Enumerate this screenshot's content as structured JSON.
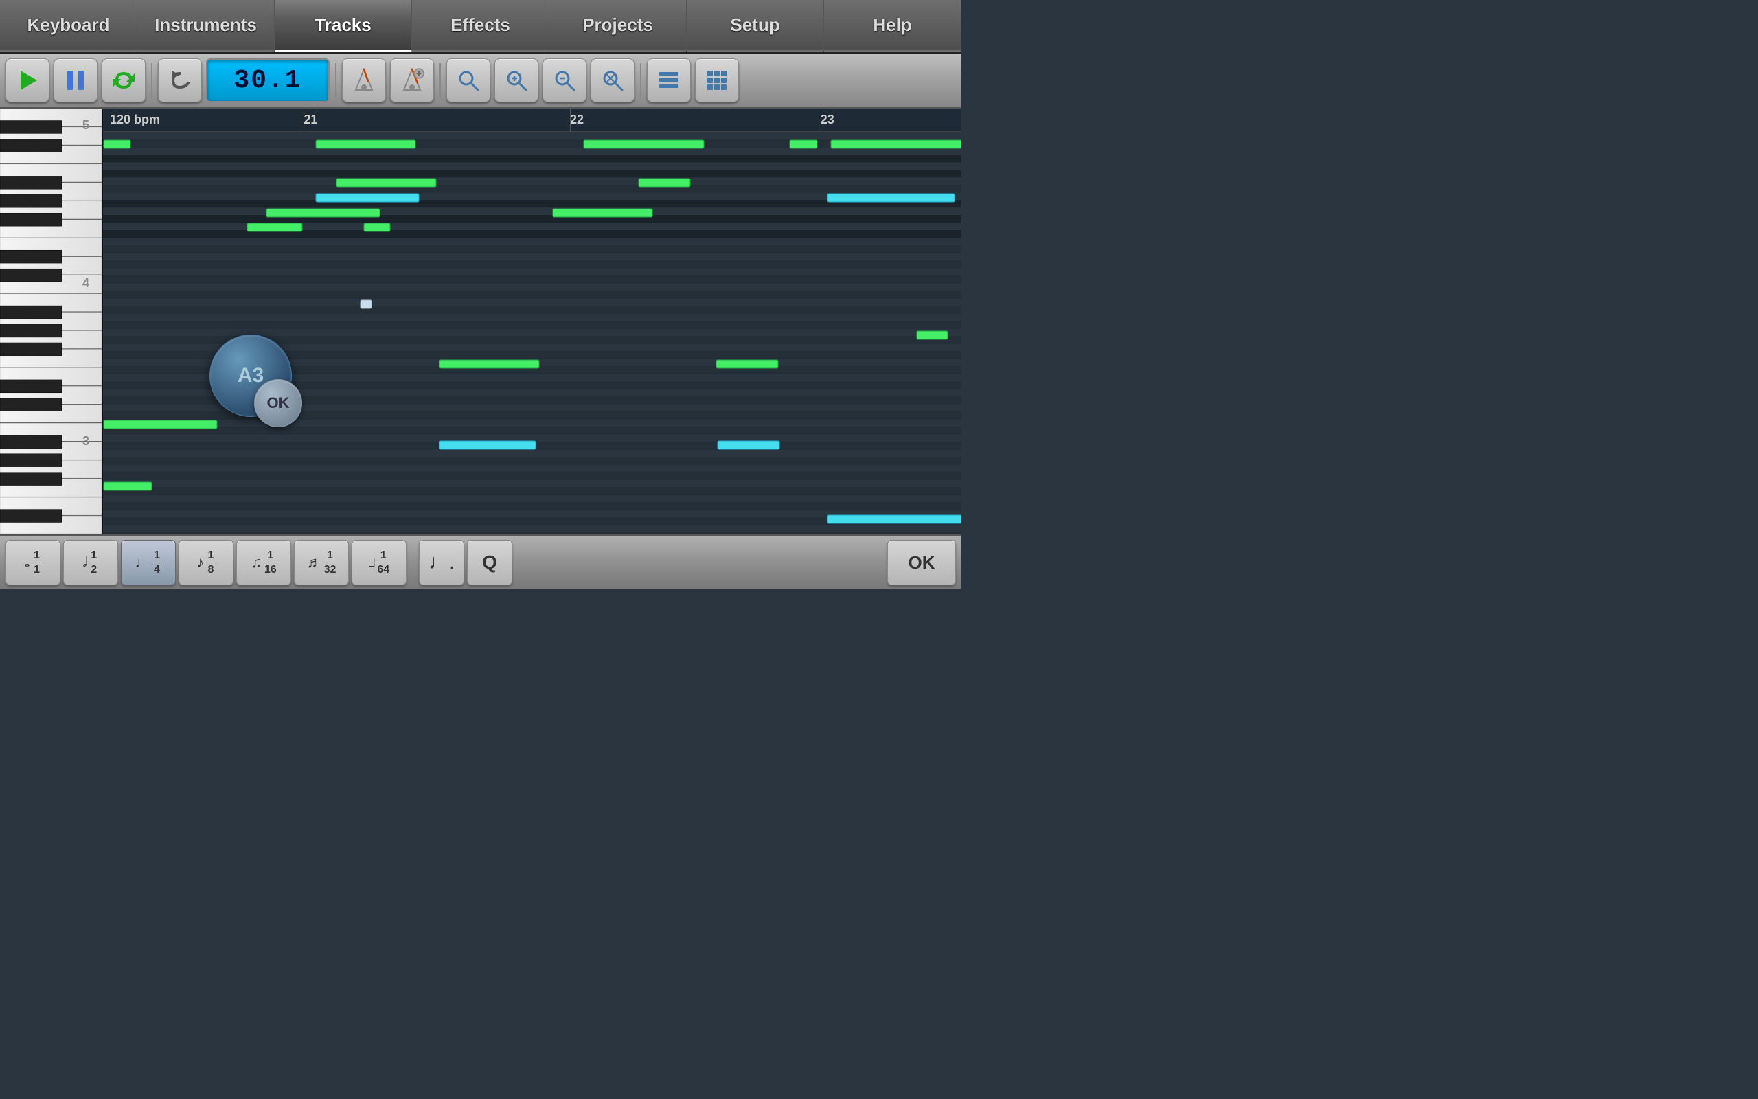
{
  "nav": {
    "tabs": [
      {
        "id": "keyboard",
        "label": "Keyboard",
        "active": false
      },
      {
        "id": "instruments",
        "label": "Instruments",
        "active": false
      },
      {
        "id": "tracks",
        "label": "Tracks",
        "active": true
      },
      {
        "id": "effects",
        "label": "Effects",
        "active": false
      },
      {
        "id": "projects",
        "label": "Projects",
        "active": false
      },
      {
        "id": "setup",
        "label": "Setup",
        "active": false
      },
      {
        "id": "help",
        "label": "Help",
        "active": false
      }
    ]
  },
  "toolbar": {
    "display_value": "30.1",
    "bpm": "120 bpm"
  },
  "timeline": {
    "markers": [
      {
        "label": "21",
        "left_pct": 16.5
      },
      {
        "label": "22",
        "left_pct": 50.5
      },
      {
        "label": "23",
        "left_pct": 82.5
      }
    ]
  },
  "note_popup": {
    "note_label": "A3",
    "ok_label": "OK"
  },
  "bottom_bar": {
    "notes": [
      {
        "id": "whole",
        "symbol": "𝅝",
        "top": "1",
        "bottom": "1",
        "active": false
      },
      {
        "id": "half",
        "symbol": "𝅗𝅥",
        "top": "1",
        "bottom": "2",
        "active": false
      },
      {
        "id": "quarter",
        "symbol": "♩",
        "top": "1",
        "bottom": "4",
        "active": true
      },
      {
        "id": "eighth",
        "symbol": "♪",
        "top": "1",
        "bottom": "8",
        "active": false
      },
      {
        "id": "sixteenth",
        "symbol": "♫",
        "top": "1",
        "bottom": "16",
        "active": false
      },
      {
        "id": "thirtysecond",
        "symbol": "♬",
        "top": "1",
        "bottom": "32",
        "active": false
      },
      {
        "id": "sixtyfourth",
        "symbol": "𝆶",
        "top": "1",
        "bottom": "64",
        "active": false
      }
    ],
    "dot_label": "·",
    "q_label": "Q",
    "ok_label": "OK"
  },
  "octave_labels": {
    "label5": "5",
    "label4": "4",
    "label3": "3"
  }
}
